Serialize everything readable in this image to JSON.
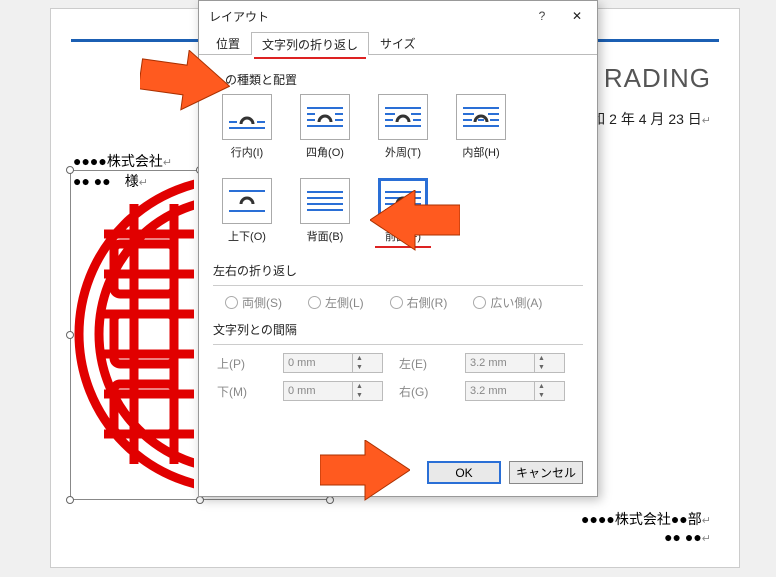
{
  "doc": {
    "heading": "RADING",
    "date": "和 2 年 4 月 23 日",
    "company_line1": "●●●●株式会社",
    "company_line2": "●● ●●　様",
    "footer1": "●●●●株式会社●●部",
    "footer2": "●● ●●"
  },
  "dialog": {
    "title": "レイアウト",
    "help": "?",
    "close": "✕",
    "tabs": {
      "pos": "位置",
      "wrap": "文字列の折り返し",
      "size": "サイズ"
    },
    "section_type": "しの種類と配置",
    "wrap_options": {
      "inline": "行内(I)",
      "square": "四角(O)",
      "tight": "外周(T)",
      "through": "内部(H)",
      "topbottom": "上下(O)",
      "behind": "背面(B)",
      "front": "前面(F)"
    },
    "section_lr": "左右の折り返し",
    "lr": {
      "both": "両側(S)",
      "left": "左側(L)",
      "right": "右側(R)",
      "wide": "広い側(A)"
    },
    "section_spacing": "文字列との間隔",
    "spacing_labels": {
      "top": "上(P)",
      "bottom": "下(M)",
      "left": "左(E)",
      "right": "右(G)"
    },
    "spacing_values": {
      "top": "0 mm",
      "bottom": "0 mm",
      "left": "3.2 mm",
      "right": "3.2 mm"
    },
    "ok": "OK",
    "cancel": "キャンセル"
  }
}
